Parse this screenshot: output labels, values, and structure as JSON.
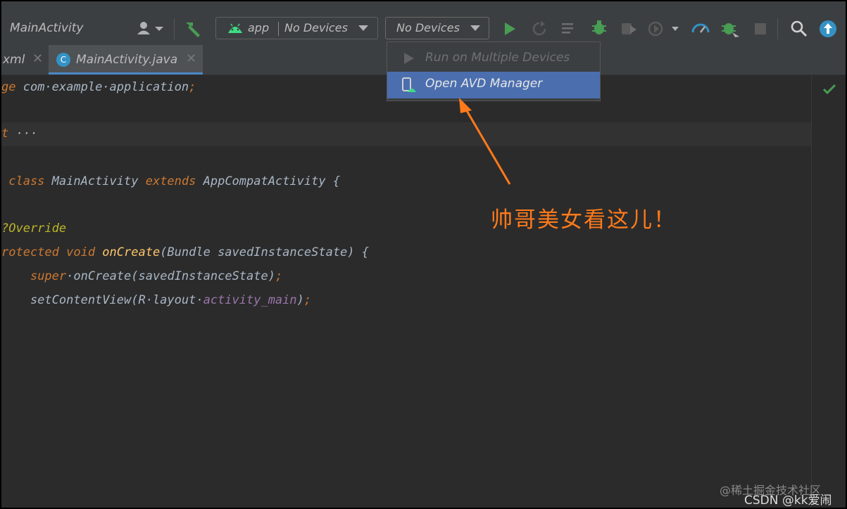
{
  "toolbar": {
    "config_name": "MainActivity",
    "module_combo": {
      "module": "app",
      "device": "No Devices"
    },
    "device_combo": "No Devices"
  },
  "tabs": [
    {
      "label": "xml",
      "icon": "file-icon"
    },
    {
      "label": "MainActivity.java",
      "icon": "class-c-icon"
    }
  ],
  "code_lines": [
    {
      "parts": [
        [
          "kw",
          "ge "
        ],
        [
          "pkg",
          "com·example·application"
        ],
        [
          "kw",
          ";"
        ]
      ]
    },
    {
      "parts": [
        [
          "kw",
          "t "
        ],
        [
          "plain",
          "···"
        ]
      ]
    },
    {
      "parts": [
        [
          "kw",
          " class "
        ],
        [
          "plain",
          "MainActivity "
        ],
        [
          "kw",
          "extends "
        ],
        [
          "plain",
          "AppCompatActivity {"
        ]
      ]
    },
    {
      "parts": [
        [
          "ann",
          "?Override"
        ]
      ]
    },
    {
      "parts": [
        [
          "kw",
          "rotected void "
        ],
        [
          "fn",
          "onCreate"
        ],
        [
          "plain",
          "(Bundle savedInstanceState) {"
        ]
      ]
    },
    {
      "parts": [
        [
          "plain",
          "    "
        ],
        [
          "kw",
          "super"
        ],
        [
          "plain",
          "·"
        ],
        [
          "fn2",
          "onCreate"
        ],
        [
          "plain",
          "(savedInstanceState)"
        ],
        [
          "kw",
          ";"
        ]
      ]
    },
    {
      "parts": [
        [
          "plain",
          "    setContentView(R·layout·"
        ],
        [
          "fld",
          "activity_main"
        ],
        [
          "plain",
          ")"
        ],
        [
          "kw",
          ";"
        ]
      ]
    }
  ],
  "dropdown_menu": {
    "items": [
      {
        "label": "Run on Multiple Devices",
        "enabled": false,
        "icon": "run-icon"
      },
      {
        "label": "Open AVD Manager",
        "enabled": true,
        "selected": true,
        "icon": "avd-manager-icon"
      }
    ]
  },
  "annotation_text": "帅哥美女看这儿！",
  "watermarks": {
    "line1": "@稀土掘金技术社区",
    "line2": "CSDN @kk爱闹"
  },
  "colors": {
    "accent_orange": "#ff7a1a",
    "selection_blue": "#4b6eaf",
    "run_green": "#499c54"
  }
}
